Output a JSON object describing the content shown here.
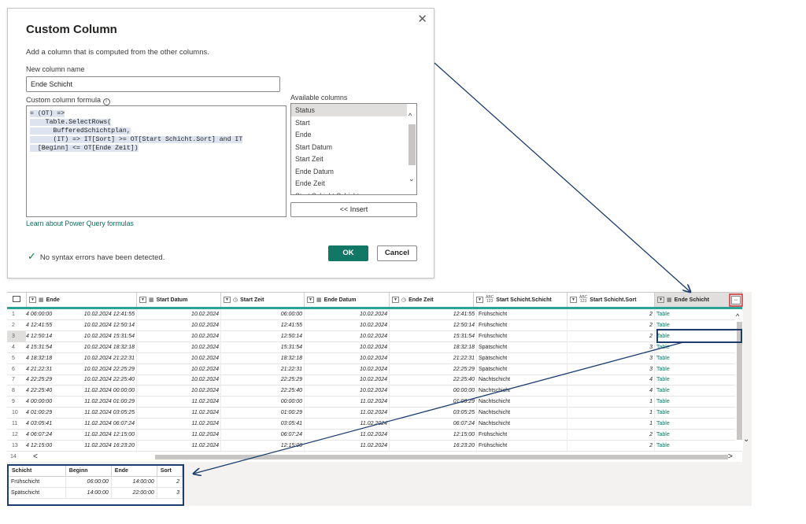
{
  "dialog": {
    "title": "Custom Column",
    "description": "Add a column that is computed from the other columns.",
    "new_column_label": "New column name",
    "new_column_value": "Ende Schicht",
    "formula_label": "Custom column formula",
    "formula_lines": [
      "= (OT) =>",
      "    Table.SelectRows(",
      "      BufferedSchichtplan,",
      "      (IT) => IT[Sort] >= OT[Start Schicht.Sort] and IT",
      "  [Beginn] <= OT[Ende Zeit])"
    ],
    "available_label": "Available columns",
    "available_columns": [
      "Status",
      "Start",
      "Ende",
      "Start Datum",
      "Start Zeit",
      "Ende Datum",
      "Ende Zeit",
      "Start Schicht.Schicht"
    ],
    "insert_label": "<< Insert",
    "learn_link": "Learn about Power Query formulas",
    "status_text": "No syntax errors have been detected.",
    "ok_label": "OK",
    "cancel_label": "Cancel"
  },
  "grid": {
    "columns": [
      {
        "label": "Ende",
        "icon": "calendar-clock-icon"
      },
      {
        "label": "Start Datum",
        "icon": "calendar-icon"
      },
      {
        "label": "Start Zeit",
        "icon": "clock-icon"
      },
      {
        "label": "Ende Datum",
        "icon": "calendar-icon"
      },
      {
        "label": "Ende Zeit",
        "icon": "clock-icon"
      },
      {
        "label": "Start Schicht.Schicht",
        "icon": "abc-123-icon"
      },
      {
        "label": "Start Schicht.Sort",
        "icon": "abc-123-icon"
      },
      {
        "label": "Ende Schicht",
        "icon": "table-icon"
      }
    ],
    "rows": [
      {
        "n": "1",
        "start": "4 06:00:00",
        "ende": "10.02.2024 12:41:55",
        "sd": "10.02.2024",
        "sz": "06:00:00",
        "ed": "10.02.2024",
        "ez": "12:41:55",
        "sch": "Frühschicht",
        "sort": "2",
        "es": "Table"
      },
      {
        "n": "2",
        "start": "4 12:41:55",
        "ende": "10.02.2024 12:50:14",
        "sd": "10.02.2024",
        "sz": "12:41:55",
        "ed": "10.02.2024",
        "ez": "12:50:14",
        "sch": "Frühschicht",
        "sort": "2",
        "es": "Table"
      },
      {
        "n": "3",
        "start": "4 12:50:14",
        "ende": "10.02.2024 15:31:54",
        "sd": "10.02.2024",
        "sz": "12:50:14",
        "ed": "10.02.2024",
        "ez": "15:31:54",
        "sch": "Frühschicht",
        "sort": "2",
        "es": "Table"
      },
      {
        "n": "4",
        "start": "4 15:31:54",
        "ende": "10.02.2024 18:32:18",
        "sd": "10.02.2024",
        "sz": "15:31:54",
        "ed": "10.02.2024",
        "ez": "18:32:18",
        "sch": "Spätschicht",
        "sort": "3",
        "es": "Table"
      },
      {
        "n": "5",
        "start": "4 18:32:18",
        "ende": "10.02.2024 21:22:31",
        "sd": "10.02.2024",
        "sz": "18:32:18",
        "ed": "10.02.2024",
        "ez": "21:22:31",
        "sch": "Spätschicht",
        "sort": "3",
        "es": "Table"
      },
      {
        "n": "6",
        "start": "4 21:22:31",
        "ende": "10.02.2024 22:25:29",
        "sd": "10.02.2024",
        "sz": "21:22:31",
        "ed": "10.02.2024",
        "ez": "22:25:29",
        "sch": "Spätschicht",
        "sort": "3",
        "es": "Table"
      },
      {
        "n": "7",
        "start": "4 22:25:29",
        "ende": "10.02.2024 22:25:40",
        "sd": "10.02.2024",
        "sz": "22:25:29",
        "ed": "10.02.2024",
        "ez": "22:25:40",
        "sch": "Nachtschicht",
        "sort": "4",
        "es": "Table"
      },
      {
        "n": "8",
        "start": "4 22:25:40",
        "ende": "11.02.2024 00:00:00",
        "sd": "10.02.2024",
        "sz": "22:25:40",
        "ed": "10.02.2024",
        "ez": "00:00:00",
        "sch": "Nachtschicht",
        "sort": "4",
        "es": "Table"
      },
      {
        "n": "9",
        "start": "4 00:00:00",
        "ende": "11.02.2024 01:00:29",
        "sd": "11.02.2024",
        "sz": "00:00:00",
        "ed": "11.02.2024",
        "ez": "01:00:29",
        "sch": "Nachtschicht",
        "sort": "1",
        "es": "Table"
      },
      {
        "n": "10",
        "start": "4 01:00:29",
        "ende": "11.02.2024 03:05:25",
        "sd": "11.02.2024",
        "sz": "01:00:29",
        "ed": "11.02.2024",
        "ez": "03:05:25",
        "sch": "Nachtschicht",
        "sort": "1",
        "es": "Table"
      },
      {
        "n": "11",
        "start": "4 03:05:41",
        "ende": "11.02.2024 06:07:24",
        "sd": "11.02.2024",
        "sz": "03:05:41",
        "ed": "11.02.2024",
        "ez": "06:07:24",
        "sch": "Nachtschicht",
        "sort": "1",
        "es": "Table"
      },
      {
        "n": "12",
        "start": "4 06:07:24",
        "ende": "11.02.2024 12:15:00",
        "sd": "11.02.2024",
        "sz": "06:07:24",
        "ed": "11.02.2024",
        "ez": "12:15:00",
        "sch": "Frühschicht",
        "sort": "2",
        "es": "Table"
      },
      {
        "n": "13",
        "start": "4 12:15:00",
        "ende": "11.02.2024 16:23:20",
        "sd": "11.02.2024",
        "sz": "12:15:00",
        "ed": "11.02.2024",
        "ez": "16:23:20",
        "sch": "Frühschicht",
        "sort": "2",
        "es": "Table"
      }
    ],
    "last_row_number": "14"
  },
  "preview": {
    "headers": [
      "Schicht",
      "Beginn",
      "Ende",
      "Sort"
    ],
    "rows": [
      [
        "Frühschicht",
        "06:00:00",
        "14:00:00",
        "2"
      ],
      [
        "Spätschicht",
        "14:00:00",
        "22:00:00",
        "3"
      ]
    ]
  },
  "colors": {
    "accent": "#117865",
    "annotation": "#1c3d6e",
    "highlight": "#d13438"
  }
}
